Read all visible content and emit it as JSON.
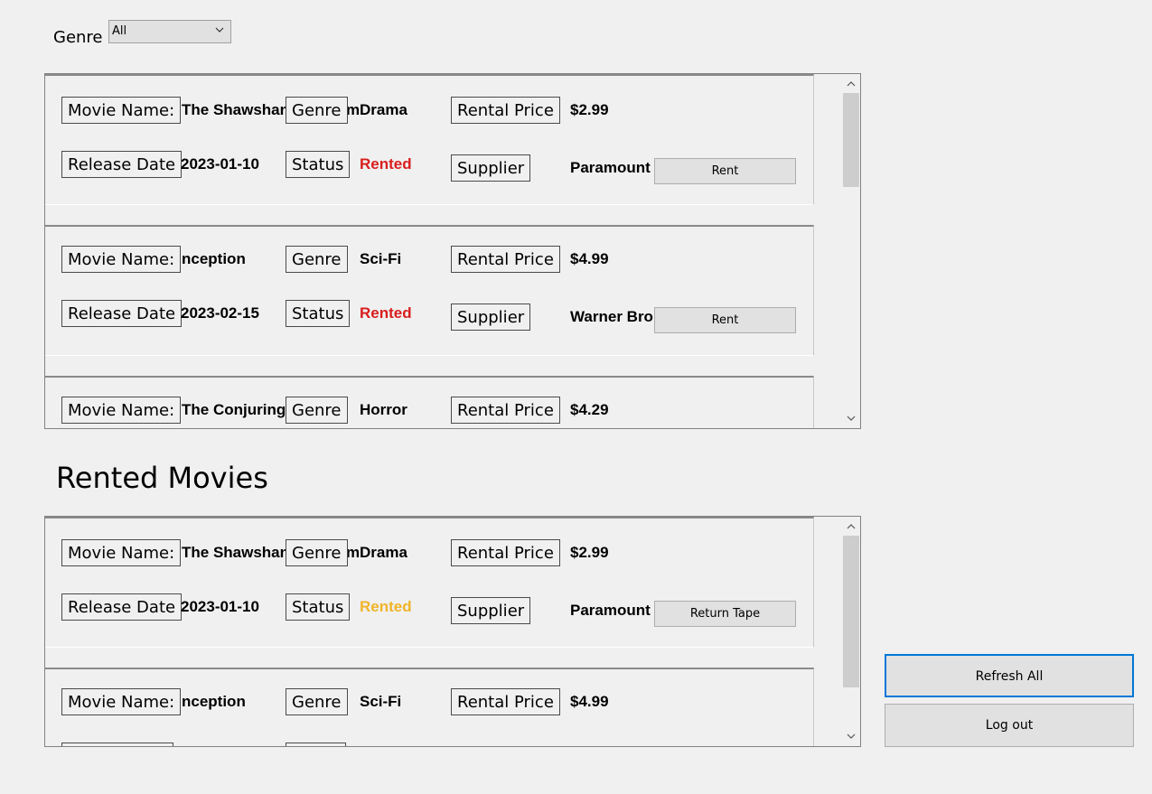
{
  "filter": {
    "label": "Genre",
    "selected": "All"
  },
  "labels": {
    "movie_name": "Movie Name:",
    "genre": "Genre",
    "rental_price": "Rental Price",
    "release_date": "Release Date",
    "status": "Status",
    "supplier": "Supplier"
  },
  "available": [
    {
      "name": "The Shawshank Redemption",
      "genre": "Drama",
      "price": "$2.99",
      "release": "2023-01-10",
      "status": "Rented",
      "supplier": "Paramount",
      "action": "Rent"
    },
    {
      "name": "Inception",
      "genre": "Sci-Fi",
      "price": "$4.99",
      "release": "2023-02-15",
      "status": "Rented",
      "supplier": "Warner Bros",
      "action": "Rent"
    },
    {
      "name": "The Conjuring",
      "genre": "Horror",
      "price": "$4.29"
    }
  ],
  "rented_title": "Rented Movies",
  "rented": [
    {
      "name": "The Shawshank Redemption",
      "genre": "Drama",
      "price": "$2.99",
      "release": "2023-01-10",
      "status": "Rented",
      "supplier": "Paramount",
      "action": "Return Tape"
    },
    {
      "name": "Inception",
      "genre": "Sci-Fi",
      "price": "$4.99"
    }
  ],
  "buttons": {
    "refresh": "Refresh All",
    "logout": "Log out"
  },
  "colors": {
    "status_available_list": "#d81e1e",
    "status_rented_list": "#f0b429",
    "focus_border": "#0078d7"
  },
  "icons": {
    "dropdown": "chevron-down-icon",
    "scroll_up": "chevron-up-icon",
    "scroll_down": "chevron-down-icon"
  }
}
